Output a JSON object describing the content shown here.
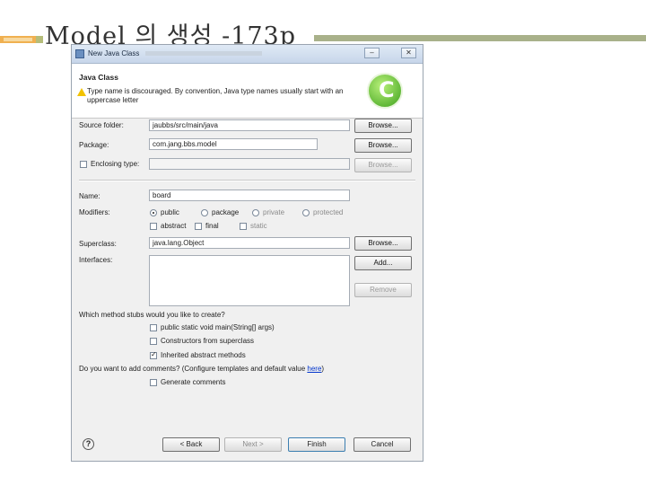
{
  "slide": {
    "title": "Model 의 생성 -173p"
  },
  "window": {
    "title": "New Java Class",
    "minimize": "–",
    "close": "✕"
  },
  "header": {
    "title": "Java Class",
    "warning": "Type name is discouraged. By convention, Java type names usually start with an uppercase letter"
  },
  "form": {
    "source_folder": {
      "label": "Source folder:",
      "value": "jaubbs/src/main/java",
      "button": "Browse..."
    },
    "package": {
      "label": "Package:",
      "value": "com.jang.bbs.model",
      "button": "Browse..."
    },
    "enclosing_type": {
      "label": "Enclosing type:",
      "value": "",
      "button": "Browse...",
      "checked": false
    },
    "name": {
      "label": "Name:",
      "value": "board"
    },
    "modifiers": {
      "label": "Modifiers:",
      "options": [
        "public",
        "package",
        "private",
        "protected"
      ],
      "selected": "public",
      "checks": [
        "abstract",
        "final",
        "static"
      ]
    },
    "superclass": {
      "label": "Superclass:",
      "value": "java.lang.Object",
      "button": "Browse..."
    },
    "interfaces": {
      "label": "Interfaces:",
      "add": "Add...",
      "remove": "Remove"
    },
    "stubs": {
      "question": "Which method stubs would you like to create?",
      "options": [
        {
          "label": "public static void main(String[] args)",
          "checked": false
        },
        {
          "label": "Constructors from superclass",
          "checked": false
        },
        {
          "label": "Inherited abstract methods",
          "checked": true
        }
      ]
    },
    "comments": {
      "question_prefix": "Do you want to add comments? (Configure templates and default value ",
      "link": "here",
      "question_suffix": ")",
      "generate": {
        "label": "Generate comments",
        "checked": false
      }
    }
  },
  "footer": {
    "help": "?",
    "back": "< Back",
    "next": "Next >",
    "finish": "Finish",
    "cancel": "Cancel"
  }
}
